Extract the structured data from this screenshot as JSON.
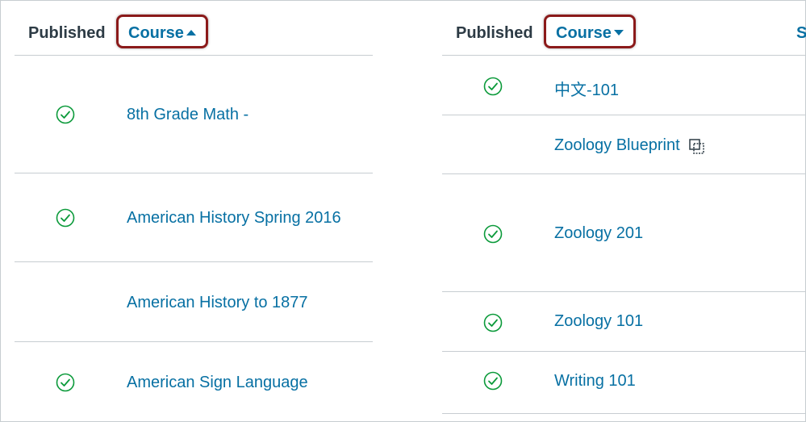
{
  "left_table": {
    "headers": {
      "published": "Published",
      "course": "Course"
    },
    "sort": "ascending",
    "rows": [
      {
        "course": "8th Grade Math -",
        "published": true
      },
      {
        "course": "American History Spring 2016",
        "published": true
      },
      {
        "course": "American History to 1877",
        "published": false
      },
      {
        "course": "American Sign Language",
        "published": true
      }
    ]
  },
  "right_table": {
    "headers": {
      "published": "Published",
      "course": "Course",
      "extra": "S"
    },
    "sort": "descending",
    "rows": [
      {
        "course": "中文-101",
        "published": true
      },
      {
        "course": "Zoology Blueprint",
        "published": false,
        "blueprint": true
      },
      {
        "course": "Zoology 201",
        "published": true
      },
      {
        "course": "Zoology 101",
        "published": true
      },
      {
        "course": "Writing 101",
        "published": true
      }
    ]
  },
  "colors": {
    "link": "#0770a3",
    "check": "#0b9a3a",
    "highlight": "#8b1a1a",
    "divider": "#c7cdd1"
  },
  "icons": {
    "published": "check-circle-icon",
    "blueprint": "blueprint-icon",
    "sort_asc": "caret-up-icon",
    "sort_desc": "caret-down-icon"
  }
}
